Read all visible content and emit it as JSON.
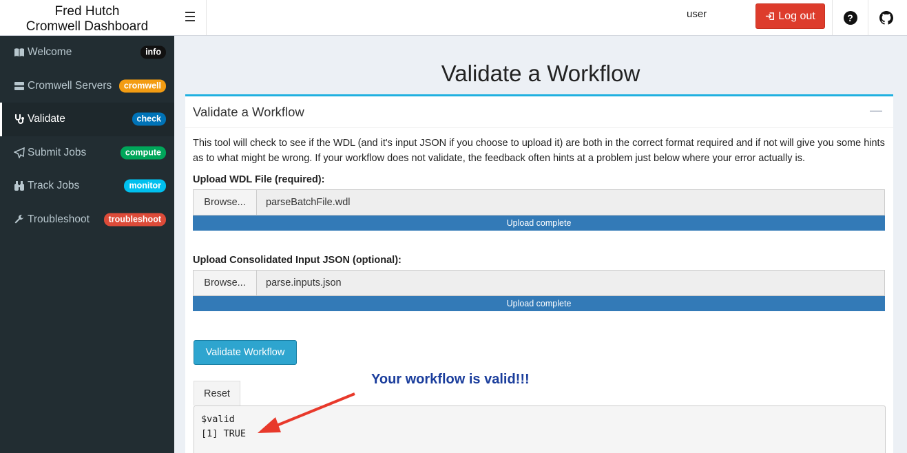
{
  "brand": {
    "line1": "Fred Hutch",
    "line2": "Cromwell Dashboard"
  },
  "header": {
    "user": "user",
    "logout_label": "Log out",
    "help_icon": "question-circle-icon",
    "github_icon": "github-icon"
  },
  "sidebar": {
    "items": [
      {
        "label": "Welcome",
        "icon": "book-open-icon",
        "badge": "info",
        "badge_color": "#111111",
        "active": false
      },
      {
        "label": "Cromwell Servers",
        "icon": "server-icon",
        "badge": "cromwell",
        "badge_color": "#f39c12",
        "active": false
      },
      {
        "label": "Validate",
        "icon": "stethoscope-icon",
        "badge": "check",
        "badge_color": "#0073b7",
        "active": true
      },
      {
        "label": "Submit Jobs",
        "icon": "paper-plane-icon",
        "badge": "compute",
        "badge_color": "#00a65a",
        "active": false
      },
      {
        "label": "Track Jobs",
        "icon": "binoculars-icon",
        "badge": "monitor",
        "badge_color": "#00c0ef",
        "active": false
      },
      {
        "label": "Troubleshoot",
        "icon": "wrench-icon",
        "badge": "troubleshoot",
        "badge_color": "#dd4b39",
        "active": false
      }
    ]
  },
  "main": {
    "page_title": "Validate a Workflow",
    "box_title": "Validate a Workflow",
    "description": "This tool will check to see if the WDL (and it's input JSON if you choose to upload it) are both in the correct format required and if not will give you some hints as to what might be wrong. If your workflow does not validate, the feedback often hints at a problem just below where your error actually is.",
    "wdl": {
      "label": "Upload WDL File (required):",
      "browse": "Browse...",
      "filename": "parseBatchFile.wdl",
      "progress": "Upload complete",
      "progress_pct": 100
    },
    "json": {
      "label": "Upload Consolidated Input JSON (optional):",
      "browse": "Browse...",
      "filename": "parse.inputs.json",
      "progress": "Upload complete",
      "progress_pct": 100
    },
    "validate_button": "Validate Workflow",
    "reset_button": "Reset",
    "output_line1": "$valid",
    "output_line2": "[1] TRUE",
    "annotation": "Your workflow is valid!!!"
  },
  "colors": {
    "sidebar_bg": "#222d32",
    "logout": "#dd3c2c",
    "validate": "#2ea5cf",
    "progress": "#337ab7",
    "annotation": "#1a3d9c",
    "arrow": "#e8392b"
  }
}
